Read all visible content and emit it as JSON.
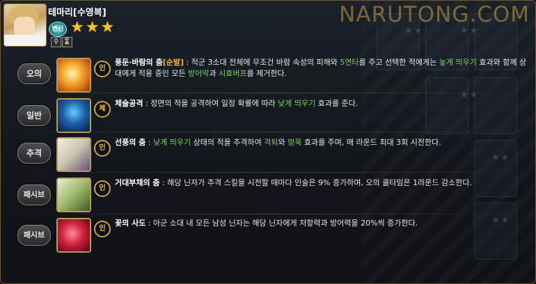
{
  "watermark": "NARUTONG.COM",
  "character": {
    "title": "테마리[수영복]",
    "badge": "변신",
    "stars": "★★★",
    "gender_icon": "♀",
    "hourglass_icon": "⌛"
  },
  "skills": [
    {
      "type": "오의",
      "seal": "인",
      "icon": "wind-spiral-icon",
      "name": "풍둔·바람의 춤",
      "tag": "[순발]",
      "segments": [
        {
          "t": " : 적군 3소대 전체에 무조건 바람 속성의 피해와 ",
          "c": ""
        },
        {
          "t": "5연타",
          "c": "g"
        },
        {
          "t": "를 주고 선택한 적에게는 ",
          "c": ""
        },
        {
          "t": "높게 띄우기",
          "c": "g"
        },
        {
          "t": " 효과와 함께 상대에게 적용 중인 모든 ",
          "c": ""
        },
        {
          "t": "방어막",
          "c": "g"
        },
        {
          "t": "과 ",
          "c": ""
        },
        {
          "t": "시효버프",
          "c": "g"
        },
        {
          "t": "를 제거한다.",
          "c": ""
        }
      ]
    },
    {
      "type": "일반",
      "seal": "체",
      "icon": "fist-glove-icon",
      "name": "체술공격",
      "tag": "",
      "segments": [
        {
          "t": " : 정면의 적을 공격하여 일정 확률에 따라 ",
          "c": ""
        },
        {
          "t": "낮게 띄우기",
          "c": "g"
        },
        {
          "t": " 효과를 준다.",
          "c": ""
        }
      ]
    },
    {
      "type": "추격",
      "seal": "인",
      "icon": "fan-icon",
      "name": "선풍의 춤",
      "tag": "",
      "segments": [
        {
          "t": " : ",
          "c": ""
        },
        {
          "t": "낮게 띄우기",
          "c": "g"
        },
        {
          "t": " 상태의 적을 추격하여 ",
          "c": ""
        },
        {
          "t": "격퇴",
          "c": "g"
        },
        {
          "t": "와 ",
          "c": ""
        },
        {
          "t": "멍목",
          "c": "g"
        },
        {
          "t": " 효과를 주며, 매 라운드 최대 3회 시전한다.",
          "c": ""
        }
      ]
    },
    {
      "type": "패시브",
      "seal": "인",
      "icon": "giant-fan-icon",
      "name": "거대부채의 춤",
      "tag": "",
      "segments": [
        {
          "t": " : 해당 닌자가 추격 스킬을 시전할 때마다 인술은 9% 증가하며, 오의 쿨타임은 1라운드 감소한다.",
          "c": ""
        }
      ]
    },
    {
      "type": "패시브",
      "seal": "인",
      "icon": "rose-icon",
      "name": "꽃의 사도",
      "tag": "",
      "segments": [
        {
          "t": " : 아군 소대 내 모든 남성 닌자는 해당 닌자에게 저항력과 방어력을 20%씩 증가한다.",
          "c": ""
        }
      ]
    }
  ]
}
